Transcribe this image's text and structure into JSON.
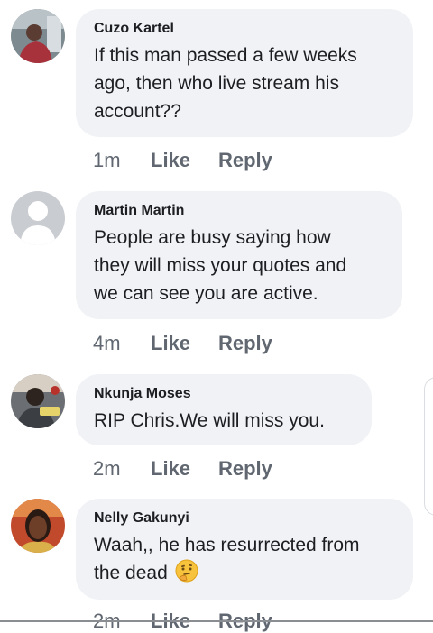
{
  "comments": [
    {
      "author": "Cuzo Kartel",
      "text": "If this man passed a few weeks\nago, then who live stream his\naccount??",
      "time": "1m",
      "like": "Like",
      "reply": "Reply",
      "avatar_icon": "person-photo"
    },
    {
      "author": "Martin Martin",
      "text": "People are busy saying how\nthey will miss your quotes and\nwe can see you are active.",
      "time": "4m",
      "like": "Like",
      "reply": "Reply",
      "avatar_icon": "default-user-silhouette"
    },
    {
      "author": "Nkunja Moses",
      "text": "RIP Chris.We will miss you.",
      "time": "2m",
      "like": "Like",
      "reply": "Reply",
      "avatar_icon": "person-photo"
    },
    {
      "author": "Nelly Gakunyi",
      "text": "Waah,, he has resurrected from\nthe dead",
      "time": "2m",
      "like": "Like",
      "reply": "Reply",
      "avatar_icon": "person-photo",
      "emoji": "thinking-face"
    }
  ],
  "colors": {
    "bubble": "#f0f2f5",
    "secondary_text": "#606770",
    "primary_text": "#1c1e21"
  }
}
